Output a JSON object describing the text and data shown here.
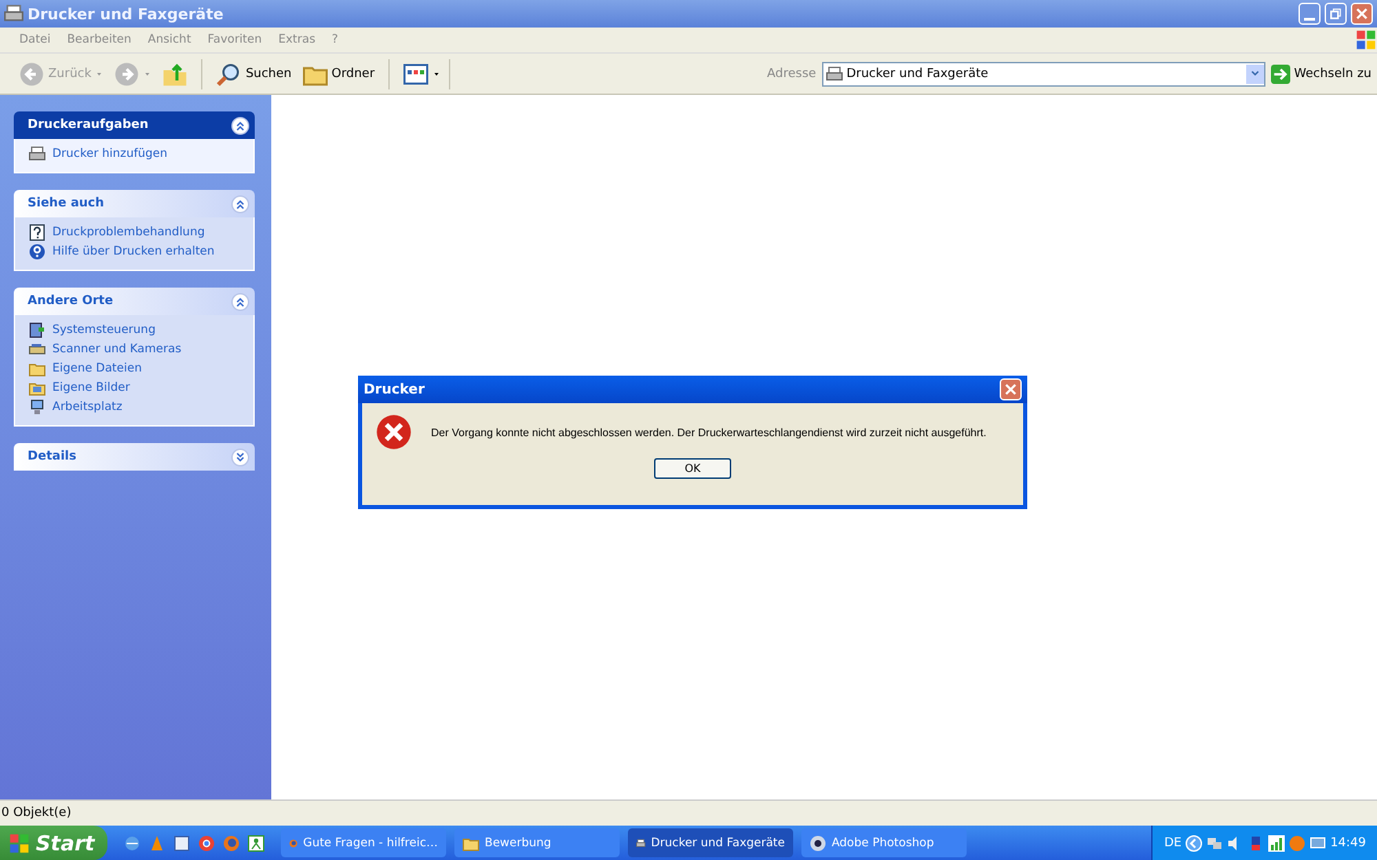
{
  "window": {
    "title": "Drucker und Faxgeräte"
  },
  "menu": [
    "Datei",
    "Bearbeiten",
    "Ansicht",
    "Favoriten",
    "Extras",
    "?"
  ],
  "toolbar": [
    {
      "kind": "back",
      "label": "Zurück",
      "disabled": true
    },
    {
      "kind": "forward",
      "disabled": true
    },
    {
      "kind": "up"
    },
    {
      "kind": "search",
      "label": "Suchen"
    },
    {
      "kind": "folders",
      "label": "Ordner"
    },
    {
      "kind": "views"
    }
  ],
  "address": {
    "label": "Adresse",
    "value": "Drucker und Faxgeräte",
    "go": "Wechseln zu"
  },
  "sidebar": [
    {
      "title": "Druckeraufgaben",
      "kind": "special",
      "expanded": true,
      "items": [
        {
          "text": "Drucker hinzufügen"
        }
      ]
    },
    {
      "title": "Siehe auch",
      "kind": "normal",
      "expanded": true,
      "items": [
        {
          "text": "Druckproblembehandlung"
        },
        {
          "text": "Hilfe über Drucken erhalten"
        }
      ]
    },
    {
      "title": "Andere Orte",
      "kind": "normal",
      "expanded": true,
      "items": [
        {
          "text": "Systemsteuerung"
        },
        {
          "text": "Scanner und Kameras"
        },
        {
          "text": "Eigene Dateien"
        },
        {
          "text": "Eigene Bilder"
        },
        {
          "text": "Arbeitsplatz"
        }
      ]
    },
    {
      "title": "Details",
      "kind": "normal",
      "expanded": false
    }
  ],
  "dialog": {
    "title": "Drucker",
    "message": "Der Vorgang konnte nicht abgeschlossen werden. Der Druckerwarteschlangendienst wird zurzeit nicht ausgeführt.",
    "button": "OK"
  },
  "status_bar": "0 Objekt(e)",
  "taskbar": {
    "start": "Start",
    "buttons": [
      {
        "label": "Gute Fragen - hilfreic…",
        "selected": false
      },
      {
        "label": "Bewerbung",
        "selected": false
      },
      {
        "label": "Drucker und Faxgeräte",
        "selected": true
      },
      {
        "label": "Adobe Photoshop",
        "selected": false
      }
    ],
    "language": "DE",
    "clock": "14:49"
  }
}
